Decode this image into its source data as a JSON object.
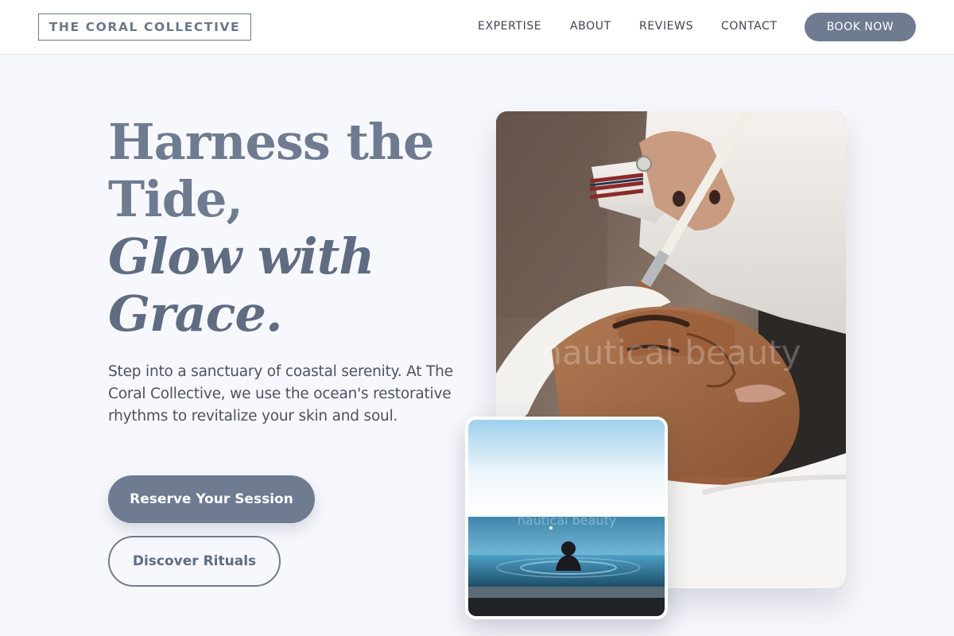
{
  "header": {
    "logo": "THE CORAL COLLECTIVE",
    "nav": [
      "EXPERTISE",
      "ABOUT",
      "REVIEWS",
      "CONTACT"
    ],
    "cta": "BOOK NOW"
  },
  "hero": {
    "headline_line1": "Harness the",
    "headline_line2": "Tide,",
    "headline_line3": "Glow with",
    "headline_line4": "Grace.",
    "intro": "Step into a sanctuary of coastal serenity. At The Coral Collective, we use the ocean's restorative rhythms to revitalize your skin and soul.",
    "primary_cta": "Reserve Your Session",
    "secondary_cta": "Discover Rituals"
  },
  "images": {
    "main_watermark": "nautical beauty",
    "small_watermark": "nautical beauty"
  },
  "colors": {
    "accent": "#6e7b91",
    "background": "#f7f8fd",
    "text": "#4b5261"
  }
}
